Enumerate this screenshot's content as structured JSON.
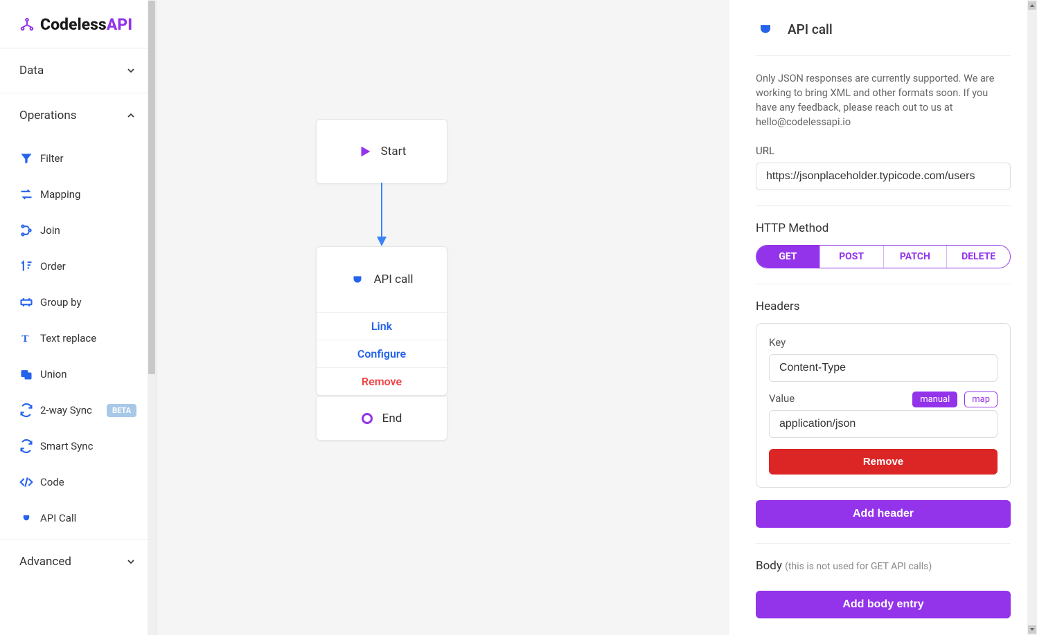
{
  "logo": {
    "name": "Codeless",
    "suffix": "API"
  },
  "sidebar": {
    "sections": {
      "data": {
        "title": "Data",
        "expanded": false
      },
      "operations": {
        "title": "Operations",
        "expanded": true,
        "items": [
          {
            "label": "Filter",
            "icon": "filter-icon"
          },
          {
            "label": "Mapping",
            "icon": "mapping-icon"
          },
          {
            "label": "Join",
            "icon": "join-icon"
          },
          {
            "label": "Order",
            "icon": "order-icon"
          },
          {
            "label": "Group by",
            "icon": "groupby-icon"
          },
          {
            "label": "Text replace",
            "icon": "text-icon"
          },
          {
            "label": "Union",
            "icon": "union-icon"
          },
          {
            "label": "2-way Sync",
            "icon": "sync-icon",
            "badge": "BETA"
          },
          {
            "label": "Smart Sync",
            "icon": "sync-icon"
          },
          {
            "label": "Code",
            "icon": "code-icon"
          },
          {
            "label": "API Call",
            "icon": "plug-icon"
          }
        ]
      },
      "advanced": {
        "title": "Advanced",
        "expanded": false
      }
    }
  },
  "canvas": {
    "start": {
      "label": "Start"
    },
    "api": {
      "label": "API call",
      "actions": {
        "link": "Link",
        "configure": "Configure",
        "remove": "Remove"
      }
    },
    "end": {
      "label": "End"
    }
  },
  "panel": {
    "title": "API call",
    "info": "Only JSON responses are currently supported. We are working to bring XML and other formats soon. If you have any feedback, please reach out to us at hello@codelessapi.io",
    "url": {
      "label": "URL",
      "value": "https://jsonplaceholder.typicode.com/users"
    },
    "http_method": {
      "label": "HTTP Method",
      "options": [
        "GET",
        "POST",
        "PATCH",
        "DELETE"
      ],
      "selected": "GET"
    },
    "headers": {
      "label": "Headers",
      "entries": [
        {
          "key_label": "Key",
          "key": "Content-Type",
          "value_label": "Value",
          "value": "application/json"
        }
      ],
      "manual": "manual",
      "map": "map",
      "remove": "Remove",
      "add": "Add header"
    },
    "body": {
      "label": "Body",
      "hint": "(this is not used for GET API calls)",
      "add": "Add body entry"
    }
  }
}
